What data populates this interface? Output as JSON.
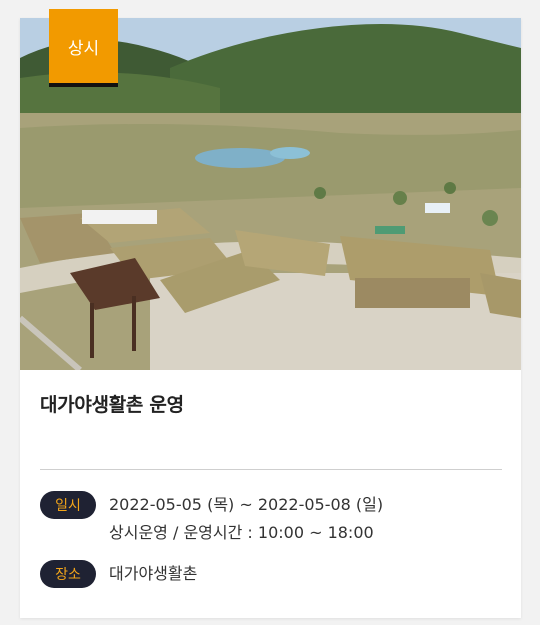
{
  "badge": {
    "label": "상시"
  },
  "event": {
    "title": "대가야생활촌 운영"
  },
  "schedule": {
    "label": "일시",
    "date_range": "2022-05-05 (목) ~ 2022-05-08 (일)",
    "hours": "상시운영 / 운영시간 : 10:00 ~ 18:00"
  },
  "place": {
    "label": "장소",
    "value": "대가야생활촌"
  },
  "colors": {
    "badge": "#f29a00",
    "pill_bg": "#1f2233",
    "pill_text": "#f2a51a"
  }
}
